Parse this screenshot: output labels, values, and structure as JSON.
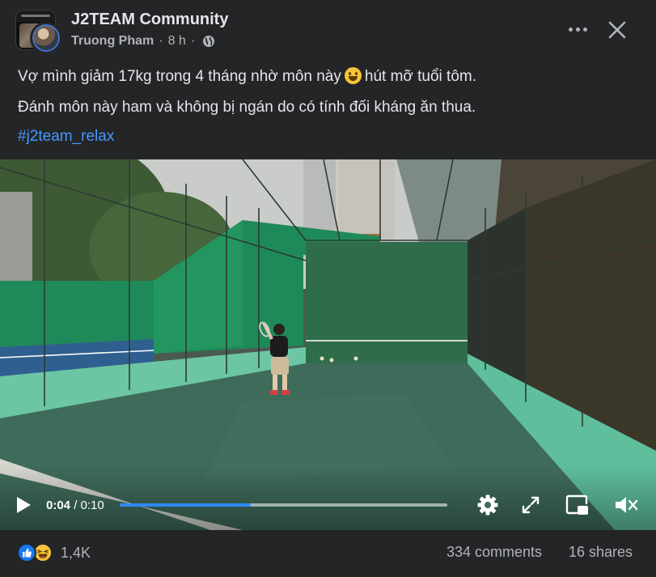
{
  "header": {
    "group_name": "J2TEAM Community",
    "author": "Truong Pham",
    "separator": "·",
    "time_ago": "8 h",
    "privacy_icon": "globe-icon",
    "more_icon": "more-horizontal-icon",
    "close_icon": "close-icon"
  },
  "post": {
    "line1_before": "Vợ mình giảm 17kg trong 4 tháng nhờ môn này",
    "line1_emoji": "grinning-face-emoji",
    "line1_after": "hút mỡ tuổi tôm.",
    "line2": "Đánh môn này ham và không bị ngán do có tính đối kháng ăn thua.",
    "hashtag": "#j2team_relax"
  },
  "video": {
    "current_time": "0:04",
    "separator": "/",
    "duration": "0:10",
    "progress": 0.4,
    "accent_color": "#2d88ff",
    "icons": [
      "play-icon",
      "settings-icon",
      "fullscreen-icon",
      "picture-in-picture-icon",
      "mute-icon"
    ]
  },
  "footer": {
    "reaction_icons": [
      "like-icon",
      "haha-icon"
    ],
    "reaction_count": "1,4K",
    "comments": "334 comments",
    "shares": "16 shares"
  }
}
